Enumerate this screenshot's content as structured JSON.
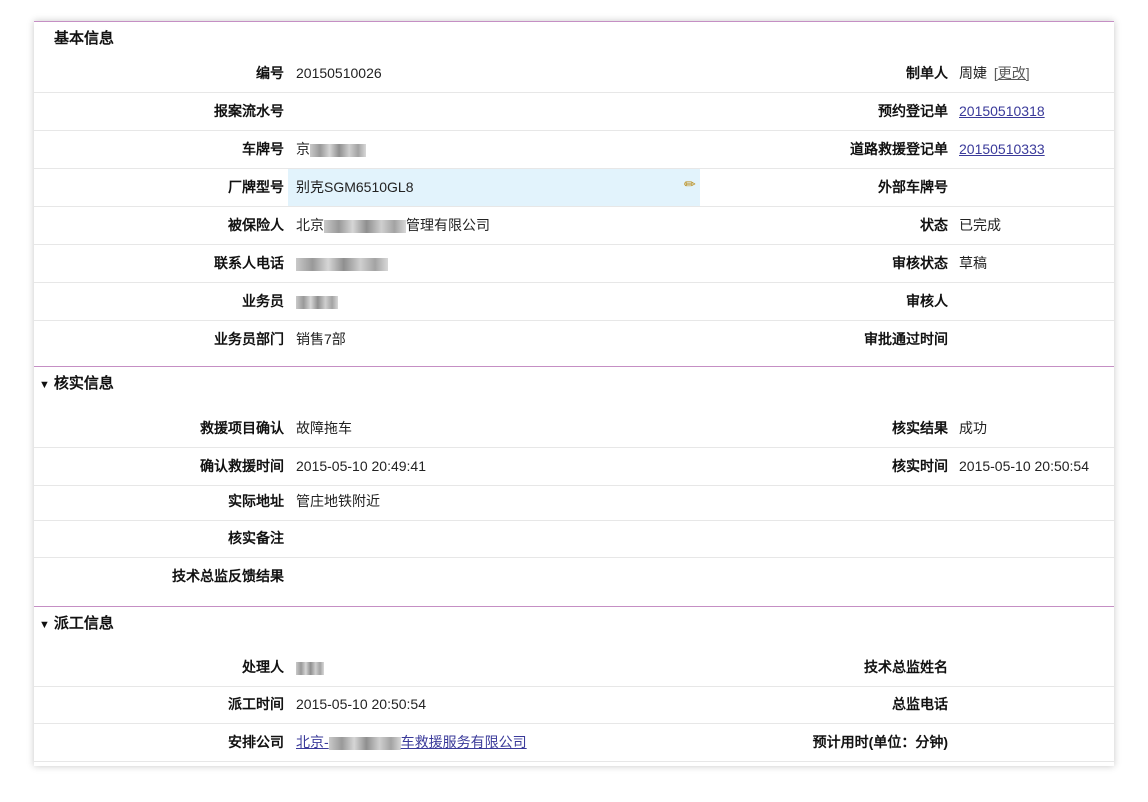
{
  "sections": {
    "basic": "基本信息",
    "verify": "核实信息",
    "dispatch": "派工信息"
  },
  "basic": {
    "no_label": "编号",
    "no_value": "20150510026",
    "creator_label": "制单人",
    "creator_value": "周婕",
    "creator_edit": "[更改]",
    "report_label": "报案流水号",
    "booking_label": "预约登记单",
    "booking_value": "20150510318",
    "plate_label": "车牌号",
    "plate_prefix": "京",
    "road_label": "道路救援登记单",
    "road_value": "20150510333",
    "model_label": "厂牌型号",
    "model_value": "别克SGM6510GL8",
    "ext_plate_label": "外部车牌号",
    "insured_label": "被保险人",
    "insured_prefix": "北京",
    "insured_suffix": "管理有限公司",
    "status_label": "状态",
    "status_value": "已完成",
    "phone_label": "联系人电话",
    "audit_status_label": "审核状态",
    "audit_status_value": "草稿",
    "salesman_label": "业务员",
    "auditor_label": "审核人",
    "dept_label": "业务员部门",
    "dept_value": "销售7部",
    "approve_time_label": "审批通过时间"
  },
  "verify": {
    "project_label": "救援项目确认",
    "project_value": "故障拖车",
    "result_label": "核实结果",
    "result_value": "成功",
    "confirm_time_label": "确认救援时间",
    "confirm_time_value": "2015-05-10 20:49:41",
    "verify_time_label": "核实时间",
    "verify_time_value": "2015-05-10 20:50:54",
    "address_label": "实际地址",
    "address_value": "管庄地铁附近",
    "remark_label": "核实备注",
    "feedback_label": "技术总监反馈结果"
  },
  "dispatch": {
    "handler_label": "处理人",
    "director_label": "技术总监姓名",
    "dispatch_time_label": "派工时间",
    "dispatch_time_value": "2015-05-10 20:50:54",
    "director_phone_label": "总监电话",
    "company_label": "安排公司",
    "company_prefix": "北京-",
    "company_suffix": "车救援服务有限公司",
    "eta_label": "预计用时(单位：分钟)"
  }
}
